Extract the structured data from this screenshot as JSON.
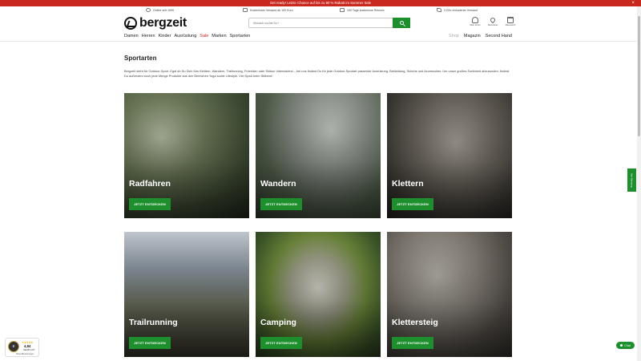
{
  "promo": {
    "text": "Get ready! Letzte Chance auf bis zu 90 % Rabatt im Summer Sale",
    "close": "×"
  },
  "usp": [
    {
      "label": "Online seit 1999",
      "icon": "globe-icon"
    },
    {
      "label": "Kostenloser Versand ab 100 Euro",
      "icon": "truck-icon"
    },
    {
      "label": "100 Tage kostenlose Retoure",
      "icon": "return-box-icon"
    },
    {
      "label": "CO2e-reduzierter Versand",
      "icon": "leaf-icon"
    }
  ],
  "header": {
    "logo": "bergzeit",
    "search_placeholder": "Wonach suchst Du?",
    "icons": [
      {
        "label": "Mein Konto",
        "icon": "user-icon"
      },
      {
        "label": "Merkzettel",
        "icon": "heart-icon"
      },
      {
        "label": "Warenkorb",
        "icon": "bag-icon"
      }
    ]
  },
  "nav": {
    "items": [
      "Damen",
      "Herren",
      "Kinder",
      "Ausrüstung",
      "Sale",
      "Marken",
      "Sportarten"
    ],
    "right": [
      "Shop",
      "Magazin",
      "Second Hand"
    ]
  },
  "page": {
    "title": "Sportarten",
    "intro": "Bergzeit steht für Outdoor-Sport. Egal ob Du Dich fürs Klettern, Wandern, Trailrunning, Freeriden oder Skitour interessierst – bei uns findest Du für jede Outdoor-Sportart passende Ausrüstung, Bekleidung, Schuhe und Accessoires. Um unser großes Sortiment abzurunden, findest Du außerdem noch jede Menge Produkte aus den Bereichen Yoga sowie Lifestyle. Viel Spaß beim Stöbern!"
  },
  "cards": [
    {
      "title": "Radfahren",
      "button": "JETZT ENTDECKEN"
    },
    {
      "title": "Wandern",
      "button": "JETZT ENTDECKEN"
    },
    {
      "title": "Klettern",
      "button": "JETZT ENTDECKEN"
    },
    {
      "title": "Trailrunning",
      "button": "JETZT ENTDECKEN"
    },
    {
      "title": "Camping",
      "button": "JETZT ENTDECKEN"
    },
    {
      "title": "Klettersteig",
      "button": "JETZT ENTDECKEN"
    }
  ],
  "widgets": {
    "feedback_tab": "Ihre Meinung",
    "trust": {
      "stars": "★★★★★",
      "score": "4,84",
      "grade": "SEHR GUT",
      "label": "Shop-Bewertungen"
    },
    "chat": "Chat"
  },
  "colors": {
    "brand_green": "#1e8f2d",
    "promo_red": "#c8281e"
  }
}
